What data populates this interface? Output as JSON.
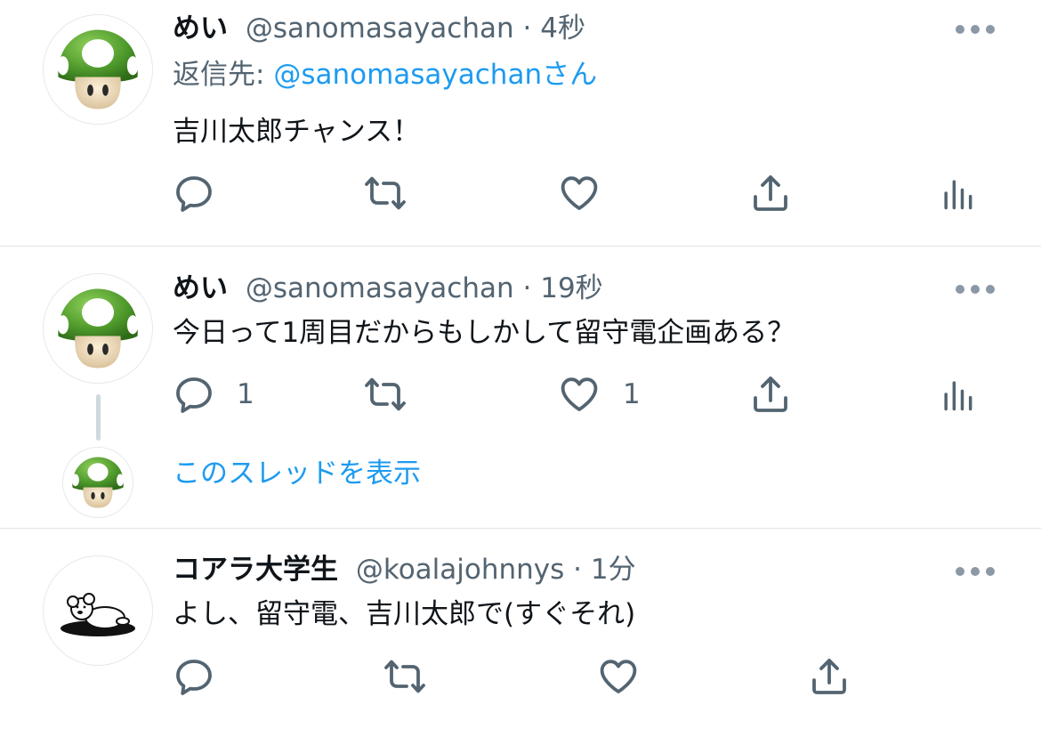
{
  "tweets": [
    {
      "name": "めい",
      "handle": "@sanomasayachan",
      "separator": "·",
      "time": "4秒",
      "reply_label": "返信先: ",
      "reply_handle": "@sanomasayachan",
      "reply_suffix": "さん",
      "text": "吉川太郎チャンス！",
      "avatar_icon": "green-mushroom-icon"
    },
    {
      "name": "めい",
      "handle": "@sanomasayachan",
      "separator": "·",
      "time": "19秒",
      "text": "今日って1周目だからもしかして留守電企画ある？",
      "reply_count": "1",
      "like_count": "1",
      "avatar_icon": "green-mushroom-icon"
    },
    {
      "name": "コアラ大学生",
      "handle": "@koalajohnnys",
      "separator": "·",
      "time": "1分",
      "text": "よし、留守電、吉川太郎で(すぐそれ)",
      "avatar_icon": "koala-icon"
    }
  ],
  "thread": {
    "show_thread_label": "このスレッドを表示",
    "avatar_icon": "green-mushroom-icon"
  },
  "icons": [
    "reply-icon",
    "retweet-icon",
    "like-icon",
    "share-icon",
    "analytics-icon",
    "more-icon"
  ],
  "colors": {
    "link": "#1d9bf0",
    "secondary_text": "#536471",
    "icon": "#536471",
    "divider": "#e1e4e7",
    "mushroom_green": "#5aa532"
  }
}
